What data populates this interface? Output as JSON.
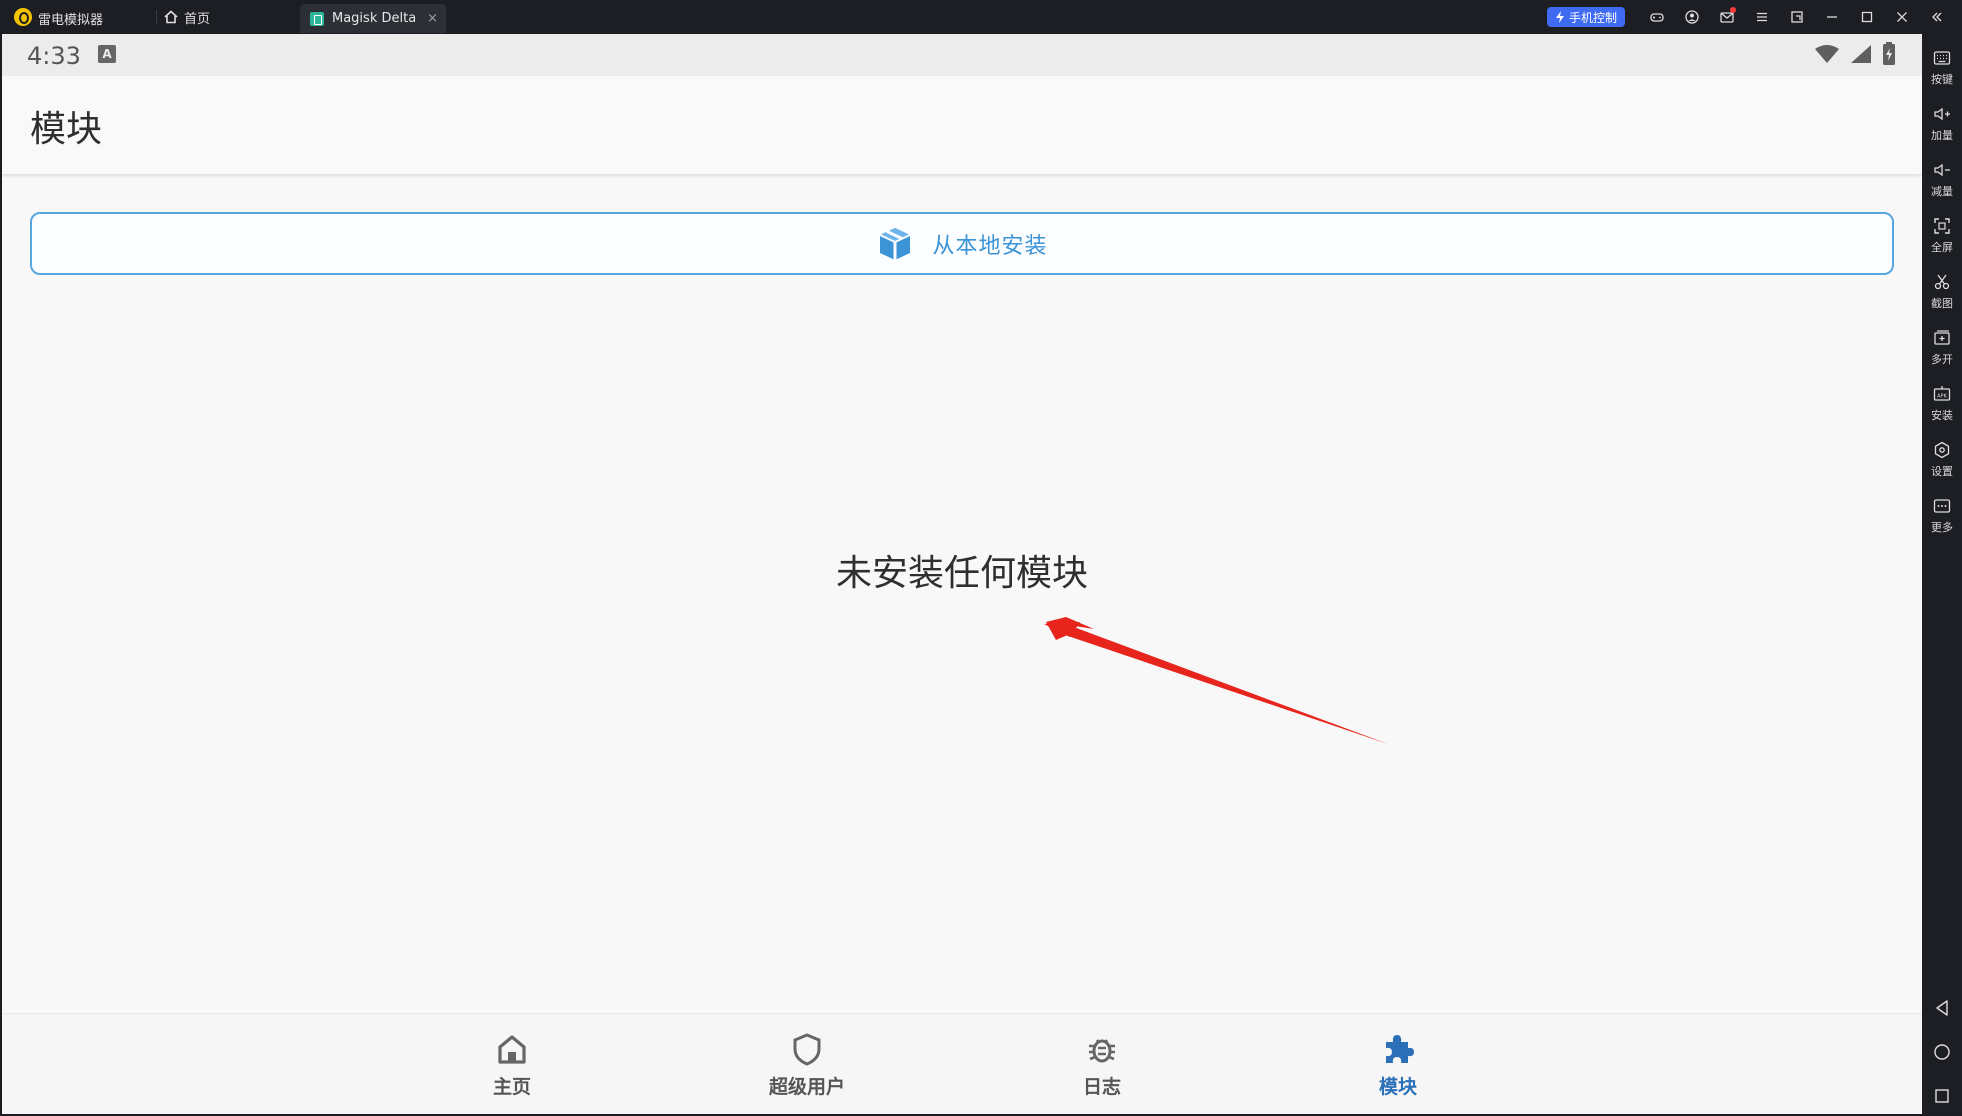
{
  "emulator": {
    "app_name": "雷电模拟器",
    "home_tab_label": "首页",
    "active_tab_label": "Magisk Delta",
    "tab_close_glyph": "×",
    "phone_control_label": "手机控制",
    "titlebar_icons": [
      "gamepad-icon",
      "user-icon",
      "mail-icon",
      "menu-icon",
      "restore-icon",
      "minimize-icon",
      "maximize-icon",
      "close-icon",
      "collapse-icon"
    ],
    "side_toolbar": [
      {
        "label": "按键",
        "icon": "keyboard-icon"
      },
      {
        "label": "加量",
        "icon": "volume-up-icon"
      },
      {
        "label": "减量",
        "icon": "volume-down-icon"
      },
      {
        "label": "全屏",
        "icon": "fullscreen-icon"
      },
      {
        "label": "截图",
        "icon": "scissors-icon"
      },
      {
        "label": "多开",
        "icon": "multi-instance-icon"
      },
      {
        "label": "安装",
        "icon": "apk-install-icon"
      },
      {
        "label": "设置",
        "icon": "settings-icon"
      },
      {
        "label": "更多",
        "icon": "more-icon"
      }
    ],
    "side_nav": [
      "back-icon",
      "home-circle-icon",
      "recents-icon"
    ],
    "accent_color": "#3e6bf2"
  },
  "android": {
    "status_bar": {
      "time": "4:33",
      "notification_badge": "A",
      "icons": [
        "wifi-icon",
        "signal-icon",
        "battery-icon"
      ]
    },
    "app_bar": {
      "title": "模块"
    },
    "install_button": {
      "label": "从本地安装",
      "icon": "package-icon",
      "color": "#3b94d6"
    },
    "empty_state": {
      "text": "未安装任何模块"
    },
    "annotation": {
      "type": "red-arrow",
      "color": "#e8251c"
    },
    "bottom_nav": {
      "items": [
        {
          "label": "主页",
          "icon": "home-icon",
          "active": false
        },
        {
          "label": "超级用户",
          "icon": "shield-icon",
          "active": false
        },
        {
          "label": "日志",
          "icon": "bug-icon",
          "active": false
        },
        {
          "label": "模块",
          "icon": "puzzle-icon",
          "active": true
        }
      ],
      "active_color": "#2a6fb8"
    }
  }
}
